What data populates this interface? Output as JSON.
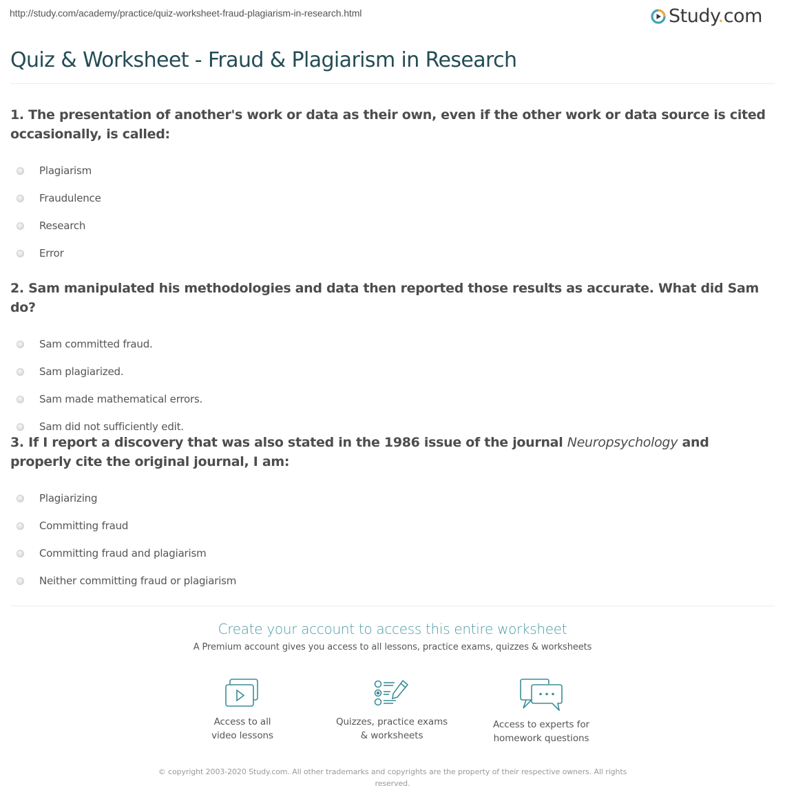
{
  "page": {
    "url": "http://study.com/academy/practice/quiz-worksheet-fraud-plagiarism-in-research.html",
    "title": "Quiz & Worksheet - Fraud & Plagiarism in Research"
  },
  "logo": {
    "icon": "play-circle-logo-icon",
    "name": "Study",
    "dot": ".",
    "tld": "com",
    "colors": {
      "ring_teal": "#3fa3b7",
      "ring_orange": "#f3a73b",
      "text": "#3b3b3b"
    }
  },
  "questions": [
    {
      "number": "1.",
      "text": "The presentation of another's work or data as their own, even if the other work or data source is cited occasionally, is called:",
      "answers": [
        "Plagiarism",
        "Fraudulence",
        "Research",
        "Error"
      ]
    },
    {
      "number": "2.",
      "text": "Sam manipulated his methodologies and data then reported those results as accurate. What did Sam do?",
      "answers": [
        "Sam committed fraud.",
        "Sam plagiarized.",
        "Sam made mathematical errors.",
        "Sam did not sufficiently edit."
      ]
    },
    {
      "number": "3.",
      "text_before": "If I report a discovery that was also stated in the 1986 issue of the journal ",
      "text_italic": "Neuropsychology",
      "text_after": " and properly cite the original journal, I am:",
      "answers": [
        "Plagiarizing",
        "Committing fraud",
        "Committing fraud and plagiarism",
        "Neither committing fraud or plagiarism"
      ]
    }
  ],
  "cta": {
    "title": "Create your account to access this entire worksheet",
    "subtitle": "A Premium account gives you access to all lessons, practice exams, quizzes & worksheets",
    "accent_color": "#3a8e98",
    "features": [
      {
        "icon": "video-lessons-icon",
        "line1": "Access to all",
        "line2": "video lessons"
      },
      {
        "icon": "quiz-checklist-icon",
        "line1": "Quizzes, practice exams",
        "line2": "& worksheets"
      },
      {
        "icon": "chat-bubbles-icon",
        "line1": "Access to experts for",
        "line2": "homework questions"
      }
    ]
  },
  "footer": {
    "copyright": "© copyright 2003-2020 Study.com. All other trademarks and copyrights are the property of their respective owners. All rights reserved."
  }
}
